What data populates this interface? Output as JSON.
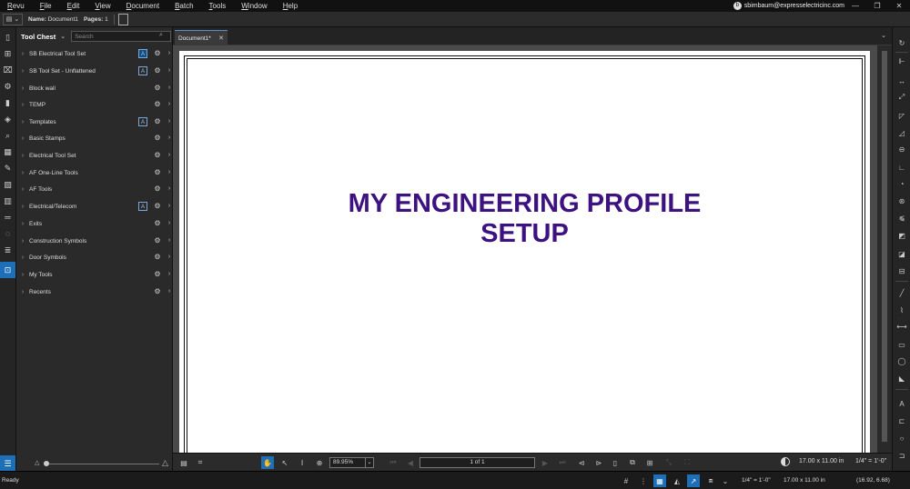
{
  "menubar": {
    "items": [
      "Revu",
      "File",
      "Edit",
      "View",
      "Document",
      "Batch",
      "Tools",
      "Window",
      "Help"
    ],
    "account_email": "sbimbaum@expresselectricinc.com"
  },
  "docbar": {
    "name_label": "Name:",
    "name_value": "Document1",
    "pages_label": "Pages:",
    "pages_value": "1"
  },
  "toolchest": {
    "title": "Tool Chest",
    "search_placeholder": "Search",
    "items": [
      {
        "label": "SB Electrical Tool Set",
        "select_icon": true,
        "selected": true
      },
      {
        "label": "SB Tool Set - Unflattened",
        "select_icon": true,
        "selected": false
      },
      {
        "label": "Block wall",
        "select_icon": false
      },
      {
        "label": "TEMP",
        "select_icon": false
      },
      {
        "label": "Templates",
        "select_icon": true,
        "selected": false
      },
      {
        "label": "Basic Stamps",
        "select_icon": false
      },
      {
        "label": "Electrical Tool Set",
        "select_icon": false
      },
      {
        "label": "AF One-Line Tools",
        "select_icon": false
      },
      {
        "label": "AF Tools",
        "select_icon": false
      },
      {
        "label": "Electrical/Telecom",
        "select_icon": true,
        "selected": false
      },
      {
        "label": "Exits",
        "select_icon": false
      },
      {
        "label": "Construction Symbols",
        "select_icon": false
      },
      {
        "label": "Door Symbols",
        "select_icon": false
      },
      {
        "label": "My Tools",
        "select_icon": false
      },
      {
        "label": "Recents",
        "select_icon": false
      }
    ]
  },
  "tabs": [
    {
      "label": "Document1*"
    }
  ],
  "document": {
    "heading_line1": "MY ENGINEERING PROFILE",
    "heading_line2": "SETUP",
    "heading_color": "#3d1280"
  },
  "navbar": {
    "zoom": "89.95%",
    "page_indicator": "1 of 1",
    "page_size": "17.00 x 11.00 in",
    "scale": "1/4\" = 1'-0\""
  },
  "statusbar": {
    "status": "Ready",
    "scale": "1/4\" = 1'-0\"",
    "page_size": "17.00 x 11.00 in",
    "coordinates": "(16.92, 6.68)"
  },
  "colors": {
    "accent": "#1d6fb8",
    "background": "#1e1e1e",
    "panel": "#2a2a2a"
  }
}
